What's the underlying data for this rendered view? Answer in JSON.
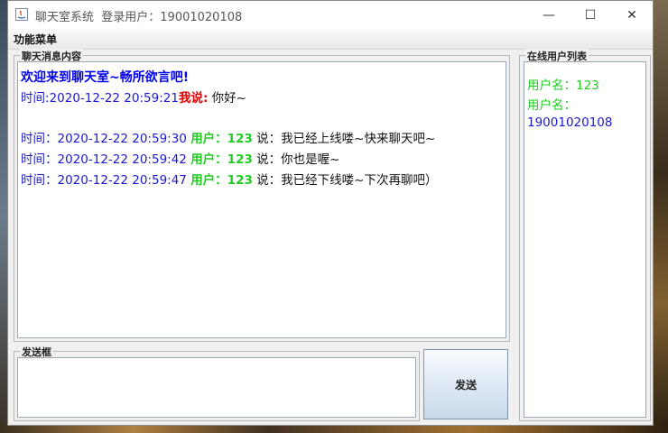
{
  "window": {
    "title": "聊天室系统",
    "login_label": "登录用户：19001020108",
    "controls": {
      "minimize": "—",
      "maximize": "☐",
      "close": "✕"
    }
  },
  "menubar": {
    "menu_label": "功能菜单"
  },
  "chat": {
    "group_title": "聊天消息内容",
    "welcome": "欢迎来到聊天室~畅所欲言吧!",
    "messages": [
      {
        "prefix": "时间:",
        "time": "2020-12-22 20:59:21",
        "who": "我说:",
        "text": " 你好~"
      },
      {
        "prefix": "时间：",
        "time": "2020-12-22 20:59:30",
        "who": "用户：123",
        "say": " 说：",
        "text": "我已经上线喽~快来聊天吧~"
      },
      {
        "prefix": "时间：",
        "time": "2020-12-22 20:59:42",
        "who": "用户：123",
        "say": " 说：",
        "text": "你也是喔~"
      },
      {
        "prefix": "时间：",
        "time": "2020-12-22 20:59:47",
        "who": "用户：123",
        "say": " 说：",
        "text": "我已经下线喽~下次再聊吧）"
      }
    ]
  },
  "users": {
    "group_title": "在线用户列表",
    "entries": [
      {
        "label": "用户名：",
        "value": "123"
      },
      {
        "label": "用户名：",
        "value": "19001020108"
      }
    ]
  },
  "send": {
    "group_title": "发送框",
    "input_value": "",
    "button_label": "发送"
  },
  "colors": {
    "welcome": "#0000ee",
    "time": "#1a1ad0",
    "me": "#e00000",
    "user": "#22cc22"
  }
}
